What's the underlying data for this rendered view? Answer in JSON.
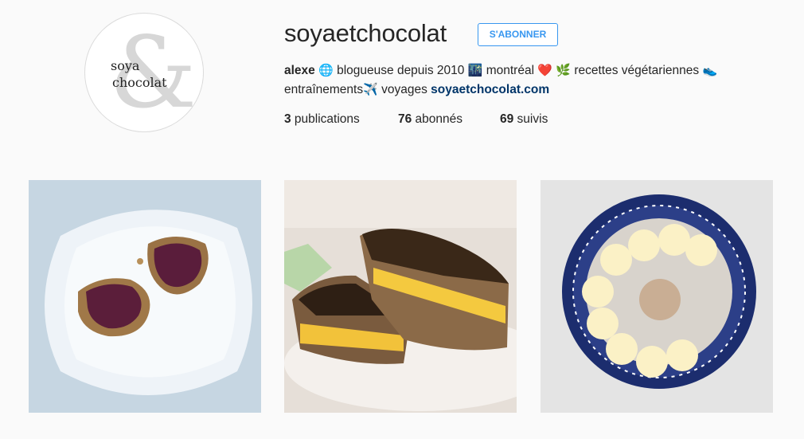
{
  "profile": {
    "username": "soyaetchocolat",
    "follow_label": "S'ABONNER",
    "avatar": {
      "line1": "soya",
      "line2": "chocolat",
      "ampersand": "&"
    },
    "bio": {
      "name": "alexe",
      "globe_icon": "🌐",
      "part1": " blogueuse depuis 2010 ",
      "city_icon": "🌃",
      "part2": " montréal ",
      "heart_icon": "❤️",
      "herb_icon": "🌿",
      "part3": " recettes végétariennes ",
      "shoe_icon": "👟",
      "part4": " entraînements",
      "plane_icon": "✈️",
      "part5": " voyages ",
      "link": "soyaetchocolat.com"
    },
    "stats": {
      "posts_count": "3",
      "posts_label": " publications",
      "followers_count": "76",
      "followers_label": " abonnés",
      "following_count": "69",
      "following_label": " suivis"
    }
  },
  "posts": [
    {
      "subject": "toast-with-jam-on-plate"
    },
    {
      "subject": "grilled-cheese-sandwich"
    },
    {
      "subject": "oatmeal-bowl-with-banana"
    }
  ],
  "colors": {
    "accent": "#3897f0",
    "link": "#003569",
    "background": "#fafafa"
  }
}
